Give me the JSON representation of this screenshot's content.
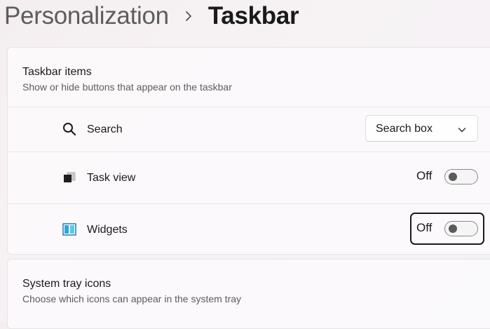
{
  "breadcrumb": {
    "parent": "Personalization",
    "separator_icon": "chevron-right-icon",
    "current": "Taskbar"
  },
  "taskbar_items": {
    "title": "Taskbar items",
    "subtitle": "Show or hide buttons that appear on the taskbar",
    "search": {
      "label": "Search",
      "icon": "search-icon",
      "dropdown_value": "Search box"
    },
    "task_view": {
      "label": "Task view",
      "icon": "task-view-icon",
      "state_label": "Off",
      "on": false
    },
    "widgets": {
      "label": "Widgets",
      "icon": "widgets-icon",
      "state_label": "Off",
      "on": false,
      "focused": true
    }
  },
  "system_tray": {
    "title": "System tray icons",
    "subtitle": "Choose which icons can appear in the system tray"
  },
  "colors": {
    "widgets_icon_accent": "#2aa8d8",
    "toggle_off_knob": "#5a5a5a",
    "focus_ring": "#1a1a1a"
  }
}
